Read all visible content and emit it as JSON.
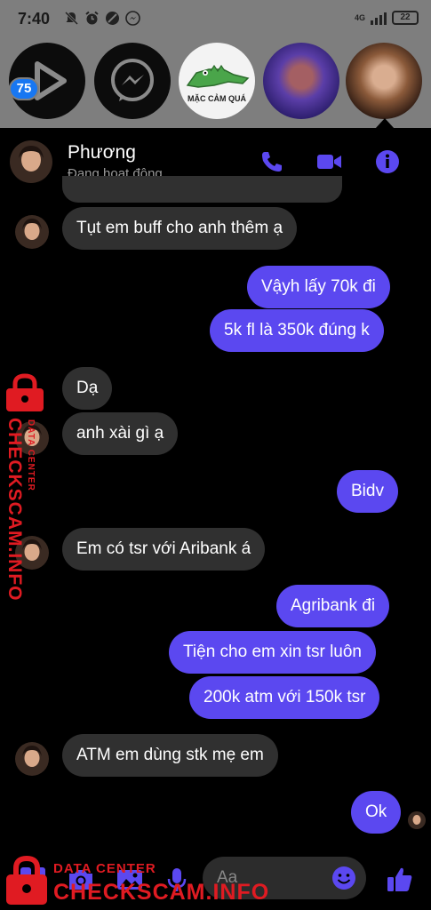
{
  "status_bar": {
    "time": "7:40",
    "network": "4G",
    "battery": "22"
  },
  "chat_heads": {
    "unread_badge": "75",
    "sticker_caption": "MẶC CẢM QUÁ"
  },
  "chat": {
    "contact_name": "Phương",
    "contact_status": "Đang hoạt động",
    "messages": [
      {
        "dir": "in",
        "text": "Tụt em buff cho anh thêm ạ"
      },
      {
        "dir": "out",
        "text": "Vậyh lấy 70k đi"
      },
      {
        "dir": "out",
        "text": "5k fl là 350k đúng k"
      },
      {
        "dir": "in",
        "text": "Dạ"
      },
      {
        "dir": "in",
        "text": "anh xài gì ạ"
      },
      {
        "dir": "out",
        "text": "Bidv"
      },
      {
        "dir": "in",
        "text": "Em có tsr với Aribank á"
      },
      {
        "dir": "out",
        "text": "Agribank đi"
      },
      {
        "dir": "out",
        "text": "Tiện cho em xin tsr luôn"
      },
      {
        "dir": "out",
        "text": "200k atm với 150k tsr"
      },
      {
        "dir": "in",
        "text": "ATM em dùng stk mẹ em"
      },
      {
        "dir": "out",
        "text": "Ok"
      }
    ]
  },
  "composer": {
    "placeholder": "Aa"
  },
  "watermark": {
    "line1": "DATA CENTER",
    "line2": "CHECKSCAM.INFO"
  },
  "colors": {
    "outgoing_bubble": "#5b48f0",
    "incoming_bubble": "#303030",
    "accent": "#5b48f0",
    "watermark": "#e01b22"
  }
}
